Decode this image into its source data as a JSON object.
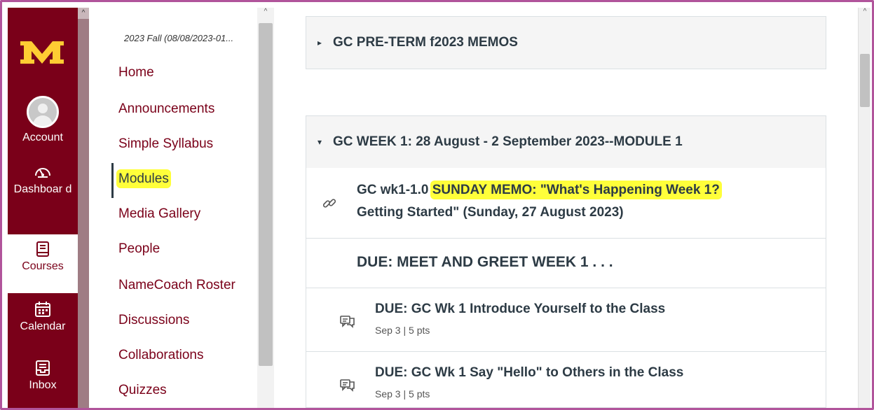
{
  "global_nav": {
    "items": [
      {
        "label": "Account",
        "icon": "account-avatar"
      },
      {
        "label": "Dashboar d",
        "icon": "speedometer-icon"
      },
      {
        "label": "Courses",
        "icon": "book-icon"
      },
      {
        "label": "Calendar",
        "icon": "calendar-icon"
      },
      {
        "label": "Inbox",
        "icon": "inbox-icon"
      }
    ],
    "active": "Courses",
    "brand_color": "#7a0019",
    "logo_color": "#ffcc33"
  },
  "course_nav": {
    "term": "2023 Fall (08/08/2023-01...",
    "items": [
      {
        "label": "Home"
      },
      {
        "label": "Announcements"
      },
      {
        "label": "Simple Syllabus"
      },
      {
        "label": "Modules"
      },
      {
        "label": "Media Gallery"
      },
      {
        "label": "People"
      },
      {
        "label": "NameCoach Roster"
      },
      {
        "label": "Discussions"
      },
      {
        "label": "Collaborations"
      },
      {
        "label": "Quizzes"
      }
    ],
    "active": "Modules",
    "highlight_color": "#ffff3a"
  },
  "modules": [
    {
      "title": "GC PRE-TERM f2023 MEMOS",
      "expanded": false
    },
    {
      "title": "GC WEEK 1: 28 August - 2 September 2023--MODULE 1",
      "expanded": true,
      "items": [
        {
          "type": "link",
          "title_prefix": "GC wk1-1.0 ",
          "title_highlight": "SUNDAY MEMO: \"What's Happening Week 1?",
          "title_rest": "Getting Started\" (Sunday, 27 August 2023)"
        },
        {
          "type": "subheader",
          "title": "DUE: MEET AND GREET WEEK 1 . . ."
        },
        {
          "type": "discussion",
          "title": "DUE: GC Wk 1 Introduce Yourself to the Class",
          "date": "Sep 3",
          "points": "5 pts"
        },
        {
          "type": "discussion",
          "title": "DUE: GC Wk 1 Say \"Hello\" to Others in the Class",
          "date": "Sep 3",
          "points": "5 pts"
        }
      ]
    }
  ],
  "meta_separator": "|"
}
